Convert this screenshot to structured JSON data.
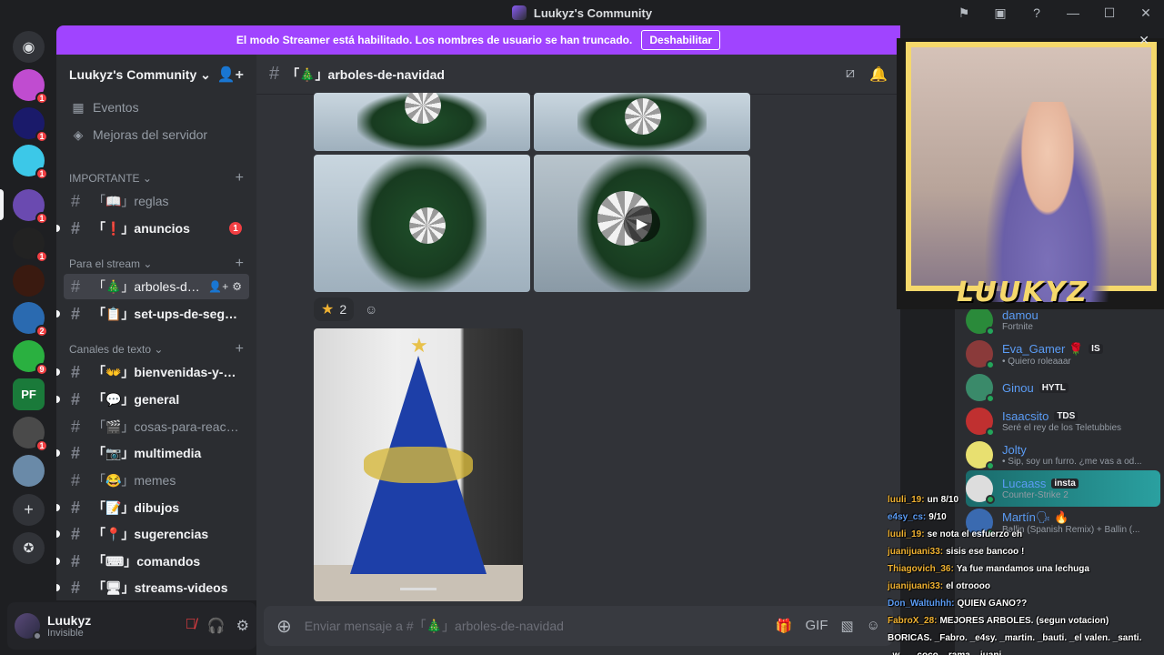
{
  "window": {
    "title": "Luukyz's Community"
  },
  "streamer_banner": {
    "text": "El modo Streamer está habilitado. Los nombres de usuario se han truncado.",
    "button": "Deshabilitar"
  },
  "guilds": [
    {
      "badge": "1",
      "color": "#c04cd0"
    },
    {
      "badge": "1",
      "color": "#1a1a6a"
    },
    {
      "badge": "1",
      "color": "#3cc8e8"
    },
    {
      "badge": "1",
      "color": "#6a4ab0"
    },
    {
      "badge": "1",
      "color": "#222222"
    },
    {
      "badge": "",
      "color": "#3a1a10"
    },
    {
      "badge": "2",
      "color": "#2a6ab0"
    },
    {
      "badge": "9",
      "color": "#2ab040"
    },
    {
      "badge": "",
      "color": "#1a7a3a",
      "label": "PF"
    },
    {
      "badge": "1",
      "color": "#4a4a4a"
    },
    {
      "badge": "",
      "color": "#6a8aa8"
    }
  ],
  "sidebar": {
    "server_name": "Luukyz's Community",
    "links": [
      {
        "icon": "▦",
        "label": "Eventos"
      },
      {
        "icon": "◈",
        "label": "Mejoras del servidor"
      }
    ],
    "categories": {
      "importante": "IMPORTANTE",
      "stream": "Para el stream",
      "texto": "Canales de texto"
    },
    "channels": {
      "reglas": "「📖」reglas",
      "anuncios": "「❗」anuncios",
      "anuncios_badge": "1",
      "arboles": "「🎄」arboles-de-n...",
      "setups": "「📋」set-ups-de-seguid...",
      "bienvenidas": "「👐」bienvenidas-y-des...",
      "general": "「💬」general",
      "cosas": "「🎬」cosas-para-reacci...",
      "multimedia": "「📷」multimedia",
      "memes": "「😂」memes",
      "dibujos": "「📝」dibujos",
      "sugerencias": "「📍」sugerencias",
      "comandos": "「⌨」comandos",
      "streams": "「🖥」streams-videos"
    }
  },
  "user": {
    "name": "Luukyz",
    "status": "Invisible"
  },
  "chat": {
    "channel_name": "「🎄」arboles-de-navidad",
    "reaction_count": "2",
    "composer_placeholder": "Enviar mensaje a #「🎄」arboles-de-navidad"
  },
  "camera": {
    "label": "LUUKYZ"
  },
  "members": [
    {
      "name": "damou",
      "tag": "",
      "activity": "Fortnite",
      "color": "#2a8a3a"
    },
    {
      "name": "Eva_Gamer 🌹",
      "tag": "IS",
      "activity": "• Quiero roleaaar",
      "color": "#8a3a3a"
    },
    {
      "name": "Ginou",
      "tag": "HYTL",
      "activity": "",
      "color": "#3a8a6a"
    },
    {
      "name": "Isaacsito",
      "tag": "TDS",
      "activity": "Seré el rey de los Teletubbies",
      "color": "#c03030"
    },
    {
      "name": "Jolty",
      "tag": "",
      "activity": "• Sip, soy un furro. ¿me vas a od...",
      "color": "#e8e070"
    },
    {
      "name": "Lucaass",
      "tag": "insta",
      "activity": "Counter-Strike 2",
      "color": "#dddddd"
    },
    {
      "name": "Martín🗣 🔥",
      "tag": "",
      "activity": "Ballin (Spanish Remix) + Ballin (...",
      "color": "#3a6ab0"
    }
  ],
  "overlay_chat": [
    {
      "name": "luuli_19:",
      "msg": "un 8/10"
    },
    {
      "name": "e4sy_cs:",
      "msg": "9/10"
    },
    {
      "name": "luuli_19:",
      "msg": "se nota el esfuerzo eh"
    },
    {
      "name": "juanijuani33:",
      "msg": "sisis ese bancoo !"
    },
    {
      "name": "Thiagovich_36:",
      "msg": "Ya fue mandamos una lechuga"
    },
    {
      "name": "juanijuani33:",
      "msg": "el otroooo"
    },
    {
      "name": "Don_Waltuhhh:",
      "msg": "QUIEN GANO??"
    },
    {
      "name": "FabroX_28:",
      "msg": "MEJORES ARBOLES. (segun votacion)"
    },
    {
      "name": "",
      "msg": "BORICAS. _Fabro. _e4sy. _martin. _bauti. _el valen. _santi."
    },
    {
      "name": "",
      "msg": "_w.... _coco. _rama. _juani"
    }
  ]
}
